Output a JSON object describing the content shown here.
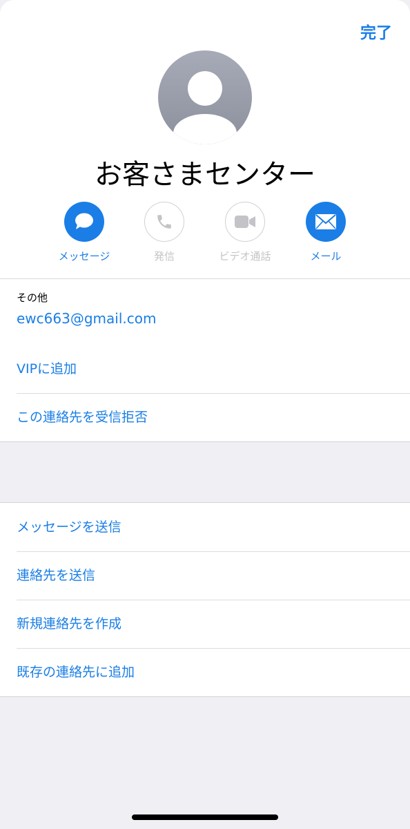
{
  "header": {
    "done_label": "完了",
    "contact_name": "お客さまセンター"
  },
  "actions": [
    {
      "label": "メッセージ",
      "enabled": true,
      "icon": "message-bubble-icon"
    },
    {
      "label": "発信",
      "enabled": false,
      "icon": "phone-icon"
    },
    {
      "label": "ビデオ通話",
      "enabled": false,
      "icon": "video-camera-icon"
    },
    {
      "label": "メール",
      "enabled": true,
      "icon": "envelope-icon"
    }
  ],
  "info": {
    "label": "その他",
    "email": "ewc663@gmail.com"
  },
  "group1": {
    "add_vip": "VIPに追加",
    "block_contact": "この連絡先を受信拒否"
  },
  "group2": {
    "send_message": "メッセージを送信",
    "share_contact": "連絡先を送信",
    "create_contact": "新規連絡先を作成",
    "add_existing": "既存の連絡先に追加"
  },
  "colors": {
    "accent": "#1a7ee6",
    "disabled": "#c4c4c8",
    "background": "#efeff4"
  }
}
